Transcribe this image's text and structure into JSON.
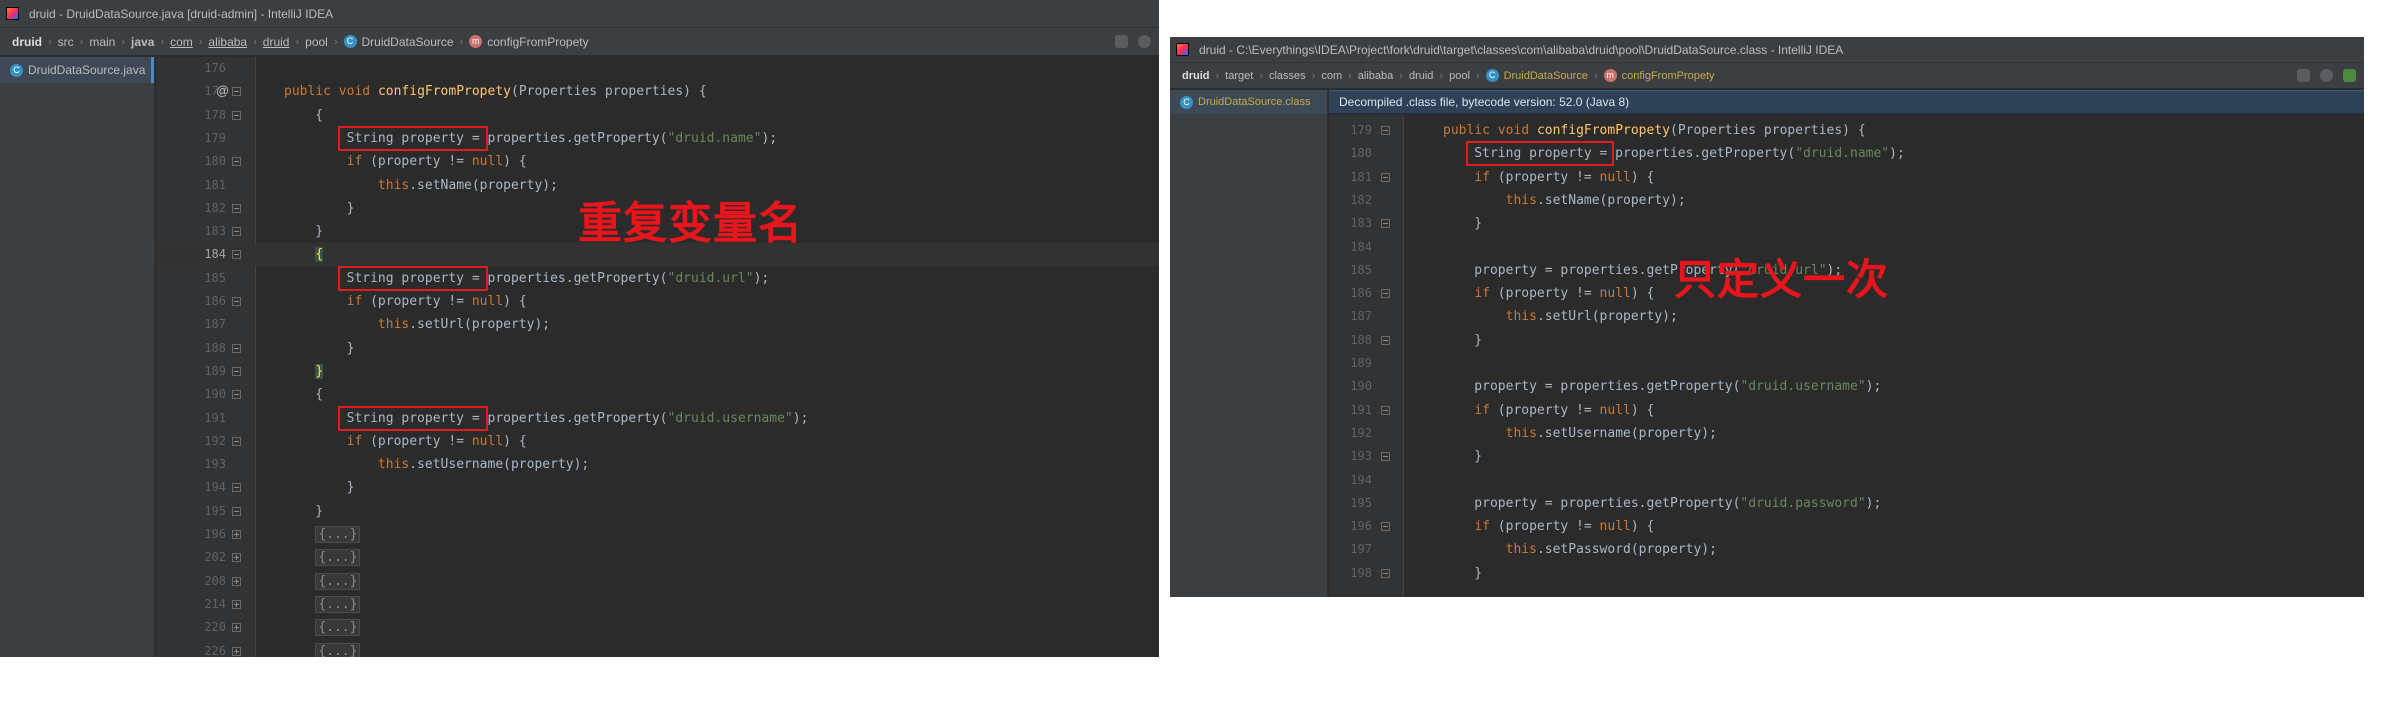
{
  "left": {
    "title": "druid - DruidDataSource.java [druid-admin] - IntelliJ IDEA",
    "breadcrumbs": [
      "druid",
      "src",
      "main",
      "java",
      "com",
      "alibaba",
      "druid",
      "pool",
      "DruidDataSource",
      "configFromPropety"
    ],
    "file_tab": "DruidDataSource.java",
    "annotation": "重复变量名",
    "lines": [
      {
        "n": "176",
        "code": ""
      },
      {
        "n": "177",
        "code": "public void configFromPropety(Properties properties) {"
      },
      {
        "n": "178",
        "code": "    {"
      },
      {
        "n": "179",
        "code": "        String property = properties.getProperty(\"druid.name\");"
      },
      {
        "n": "180",
        "code": "        if (property != null) {"
      },
      {
        "n": "181",
        "code": "            this.setName(property);"
      },
      {
        "n": "182",
        "code": "        }"
      },
      {
        "n": "183",
        "code": "    }"
      },
      {
        "n": "184",
        "code": "    {"
      },
      {
        "n": "185",
        "code": "        String property = properties.getProperty(\"druid.url\");"
      },
      {
        "n": "186",
        "code": "        if (property != null) {"
      },
      {
        "n": "187",
        "code": "            this.setUrl(property);"
      },
      {
        "n": "188",
        "code": "        }"
      },
      {
        "n": "189",
        "code": "    }"
      },
      {
        "n": "190",
        "code": "    {"
      },
      {
        "n": "191",
        "code": "        String property = properties.getProperty(\"druid.username\");"
      },
      {
        "n": "192",
        "code": "        if (property != null) {"
      },
      {
        "n": "193",
        "code": "            this.setUsername(property);"
      },
      {
        "n": "194",
        "code": "        }"
      },
      {
        "n": "195",
        "code": "    }"
      },
      {
        "n": "196",
        "code": "    {...}"
      },
      {
        "n": "202",
        "code": "    {...}"
      },
      {
        "n": "208",
        "code": "    {...}"
      },
      {
        "n": "214",
        "code": "    {...}"
      },
      {
        "n": "220",
        "code": "    {...}"
      },
      {
        "n": "226",
        "code": "    {...}"
      }
    ]
  },
  "right": {
    "title": "druid - C:\\Everythings\\IDEA\\Project\\fork\\druid\\target\\classes\\com\\alibaba\\druid\\pool\\DruidDataSource.class - IntelliJ IDEA",
    "breadcrumbs": [
      "druid",
      "target",
      "classes",
      "com",
      "alibaba",
      "druid",
      "pool",
      "DruidDataSource",
      "configFromPropety"
    ],
    "file_tab": "DruidDataSource.class",
    "info": "Decompiled .class file, bytecode version: 52.0 (Java 8)",
    "annotation": "只定义一次",
    "lines": [
      {
        "n": "179",
        "code": "public void configFromPropety(Properties properties) {"
      },
      {
        "n": "180",
        "code": "    String property = properties.getProperty(\"druid.name\");"
      },
      {
        "n": "181",
        "code": "    if (property != null) {"
      },
      {
        "n": "182",
        "code": "        this.setName(property);"
      },
      {
        "n": "183",
        "code": "    }"
      },
      {
        "n": "184",
        "code": ""
      },
      {
        "n": "185",
        "code": "    property = properties.getProperty(\"druid.url\");"
      },
      {
        "n": "186",
        "code": "    if (property != null) {"
      },
      {
        "n": "187",
        "code": "        this.setUrl(property);"
      },
      {
        "n": "188",
        "code": "    }"
      },
      {
        "n": "189",
        "code": ""
      },
      {
        "n": "190",
        "code": "    property = properties.getProperty(\"druid.username\");"
      },
      {
        "n": "191",
        "code": "    if (property != null) {"
      },
      {
        "n": "192",
        "code": "        this.setUsername(property);"
      },
      {
        "n": "193",
        "code": "    }"
      },
      {
        "n": "194",
        "code": ""
      },
      {
        "n": "195",
        "code": "    property = properties.getProperty(\"druid.password\");"
      },
      {
        "n": "196",
        "code": "    if (property != null) {"
      },
      {
        "n": "197",
        "code": "        this.setPassword(property);"
      },
      {
        "n": "198",
        "code": "    }"
      }
    ]
  }
}
